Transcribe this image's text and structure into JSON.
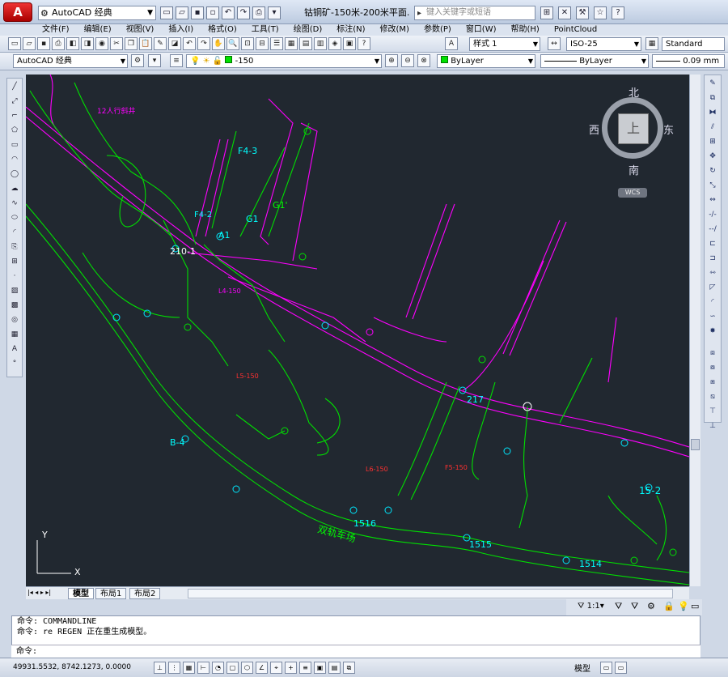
{
  "app": {
    "name": "AutoCAD 经典",
    "logo": "A"
  },
  "title": {
    "workspace": "AutoCAD 经典",
    "document": "钴铜矿-150米-200米平面...",
    "search_placeholder": "键入关键字或短语"
  },
  "menu": [
    "文件(F)",
    "编辑(E)",
    "视图(V)",
    "插入(I)",
    "格式(O)",
    "工具(T)",
    "绘图(D)",
    "标注(N)",
    "修改(M)",
    "参数(P)",
    "窗口(W)",
    "帮助(H)",
    "PointCloud"
  ],
  "toolbar": {
    "textstyle": "样式 1",
    "dimstyle": "ISO-25",
    "tablestyle": "Standard",
    "workspace": "AutoCAD 经典",
    "layer": "-150",
    "color": "ByLayer",
    "linetype": "ByLayer",
    "lineweight": "0.09 mm"
  },
  "viewcube": {
    "north": "北",
    "south": "南",
    "east": "东",
    "west": "西",
    "top": "上",
    "wcs": "WCS"
  },
  "ucs": {
    "x": "X",
    "y": "Y"
  },
  "tabs": [
    "模型",
    "布局1",
    "布局2"
  ],
  "command": {
    "line1": "命令: COMMANDLINE",
    "line2": "命令: re REGEN 正在重生成模型。",
    "prompt": "命令:"
  },
  "status": {
    "coords": "49931.5532, 8742.1273, 0.0000",
    "model": "模型",
    "scale": "1:1"
  },
  "drawing_labels": [
    {
      "text": "12人行斜井",
      "color": "#ff00ff"
    },
    {
      "text": "F4-3",
      "color": "#00ffff"
    },
    {
      "text": "G1'",
      "color": "#00ff00"
    },
    {
      "text": "G1",
      "color": "#00ffff"
    },
    {
      "text": "A1",
      "color": "#00ffff"
    },
    {
      "text": "210-1",
      "color": "#ffffff"
    },
    {
      "text": "F4-2",
      "color": "#00ffff"
    },
    {
      "text": "L4-150",
      "color": "#ff00ff"
    },
    {
      "text": "L5-150",
      "color": "#ff4444"
    },
    {
      "text": "217",
      "color": "#00ffff"
    },
    {
      "text": "1516",
      "color": "#00ffff"
    },
    {
      "text": "1515",
      "color": "#00ffff"
    },
    {
      "text": "1514",
      "color": "#00ffff"
    },
    {
      "text": "15-2",
      "color": "#00ffff"
    },
    {
      "text": "B-4",
      "color": "#00ffff"
    },
    {
      "text": "双轨车场",
      "color": "#00ff00"
    },
    {
      "text": "F5-150",
      "color": "#ff4444"
    },
    {
      "text": "L6-150",
      "color": "#ff4444"
    }
  ],
  "colors": {
    "background": "#212830",
    "magenta": "#ff00ff",
    "green": "#00ff00",
    "cyan": "#00ffff",
    "red": "#ff3030"
  }
}
